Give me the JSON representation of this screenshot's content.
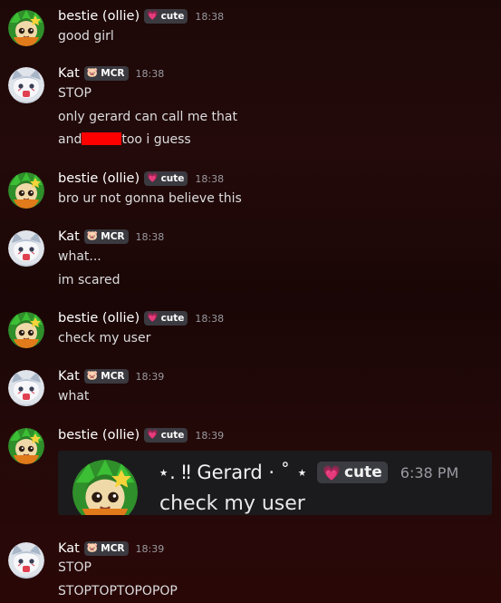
{
  "users": {
    "ollie": {
      "name": "bestie (ollie)",
      "tag_label": "cute",
      "tag_icon": "heart-icon"
    },
    "kat": {
      "name": "Kat",
      "tag_label": "MCR",
      "tag_icon": "skull-icon"
    }
  },
  "messages": [
    {
      "author": "bestie (ollie)",
      "tag": "cute",
      "time": "18:38",
      "lines": [
        "good girl"
      ]
    },
    {
      "author": "Kat",
      "tag": "MCR",
      "time": "18:38",
      "lines": [
        "STOP",
        "only gerard can call me that",
        "and",
        "too i guess"
      ]
    },
    {
      "author": "bestie (ollie)",
      "tag": "cute",
      "time": "18:38",
      "lines": [
        "bro ur not gonna believe this"
      ]
    },
    {
      "author": "Kat",
      "tag": "MCR",
      "time": "18:38",
      "lines": [
        "what...",
        "im scared"
      ]
    },
    {
      "author": "bestie (ollie)",
      "tag": "cute",
      "time": "18:38",
      "lines": [
        "check my user"
      ]
    },
    {
      "author": "Kat",
      "tag": "MCR",
      "time": "18:39",
      "lines": [
        "what"
      ]
    },
    {
      "author": "bestie (ollie)",
      "tag": "cute",
      "time": "18:39",
      "lines": []
    },
    {
      "author": "Kat",
      "tag": "MCR",
      "time": "18:39",
      "lines": [
        "STOP",
        "STOPTOPTOPOPOP"
      ]
    }
  ],
  "embed": {
    "name": "⋆. ‼ Gerard · ˚ ⋆",
    "tag_label": "cute",
    "time": "6:38 PM",
    "text": "check my user"
  },
  "colors": {
    "background": "#1f0808",
    "redaction": "#ff0000",
    "tag_bg": "#3a3a40"
  }
}
